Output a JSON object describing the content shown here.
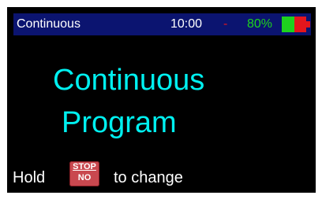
{
  "status_bar": {
    "title": "Continuous",
    "time": "10:00",
    "separator": "-",
    "battery_percent": "80%",
    "battery_level": 0.8
  },
  "main": {
    "line1": "Continuous",
    "line2": "Program"
  },
  "footer": {
    "hold_label": "Hold",
    "button_top_label": "STOP",
    "button_bottom_label": "NO",
    "change_label": "to change"
  },
  "colors": {
    "screen_background": "#000000",
    "status_bar_background": "#0b1470",
    "main_text": "#00f0f0",
    "battery_text": "#1ed21e",
    "separator": "#e4161c",
    "stop_button": "#c9484f"
  },
  "icons": {
    "battery": "battery-icon",
    "stop_button": "stop-no-button-icon"
  }
}
